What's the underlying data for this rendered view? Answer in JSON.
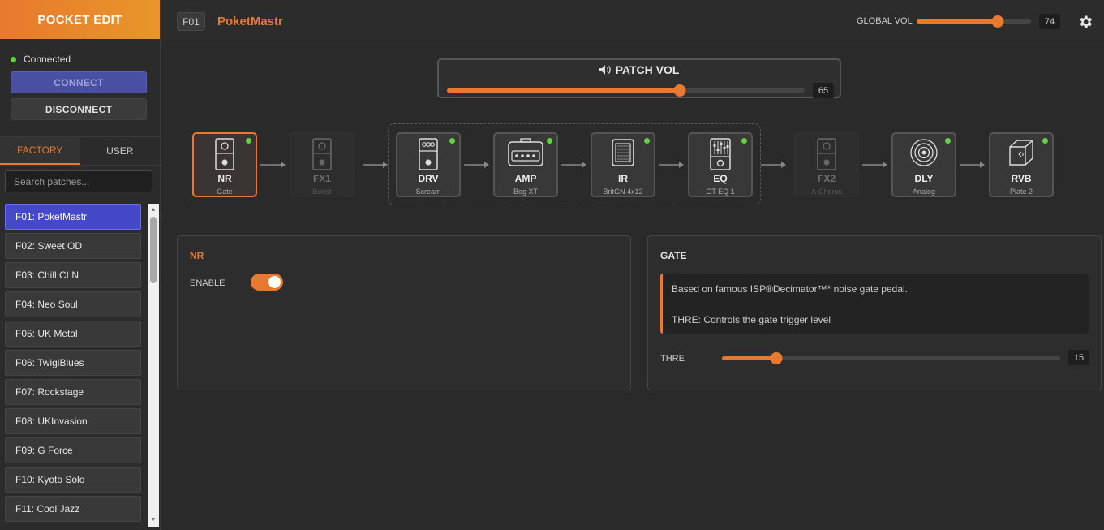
{
  "app": {
    "title": "POCKET EDIT",
    "status": "Connected",
    "connect_label": "CONNECT",
    "disconnect_label": "DISCONNECT"
  },
  "sidebar": {
    "tabs": [
      {
        "label": "FACTORY",
        "active": true
      },
      {
        "label": "USER",
        "active": false
      }
    ],
    "search_placeholder": "Search patches...",
    "patches": [
      {
        "label": "F01: PoketMastr",
        "active": true
      },
      {
        "label": "F02: Sweet OD"
      },
      {
        "label": "F03: Chill CLN"
      },
      {
        "label": "F04: Neo Soul"
      },
      {
        "label": "F05: UK Metal"
      },
      {
        "label": "F06: TwigiBlues"
      },
      {
        "label": "F07: Rockstage"
      },
      {
        "label": "F08: UKInvasion"
      },
      {
        "label": "F09: G Force"
      },
      {
        "label": "F10: Kyoto Solo"
      },
      {
        "label": "F11: Cool Jazz"
      }
    ]
  },
  "header": {
    "patch_id": "F01",
    "patch_name": "PoketMastr",
    "global_vol_label": "GLOBAL VOL",
    "global_vol": 74,
    "global_vol_fill": 0.71
  },
  "patch_vol": {
    "title": "PATCH VOL",
    "value": 65,
    "fill": 0.65
  },
  "chain": [
    {
      "name": "NR",
      "sub": "Gate",
      "on": true,
      "selected": true,
      "icon": "stompbox-icon"
    },
    {
      "name": "FX1",
      "sub": "Boost",
      "on": false,
      "icon": "stompbox-icon"
    },
    {
      "name": "DRV",
      "sub": "Scream",
      "on": true,
      "icon": "drive-pedal-icon"
    },
    {
      "name": "AMP",
      "sub": "Bog XT",
      "on": true,
      "icon": "amp-icon"
    },
    {
      "name": "IR",
      "sub": "BritGN 4x12",
      "on": true,
      "icon": "cabinet-icon"
    },
    {
      "name": "EQ",
      "sub": "GT EQ 1",
      "on": true,
      "icon": "eq-pedal-icon"
    },
    {
      "name": "FX2",
      "sub": "A-Chorus",
      "on": false,
      "icon": "stompbox-icon"
    },
    {
      "name": "DLY",
      "sub": "Analog",
      "on": true,
      "icon": "delay-icon"
    },
    {
      "name": "RVB",
      "sub": "Plate 2",
      "on": true,
      "icon": "reverb-icon"
    }
  ],
  "nr_panel": {
    "title": "NR",
    "enable_label": "ENABLE",
    "enabled": true
  },
  "gate_panel": {
    "title": "GATE",
    "info_line1": "Based on famous ISP®Decimator™* noise gate pedal.",
    "info_line2": "THRE: Controls the gate trigger level",
    "thre_label": "THRE",
    "thre_value": 15,
    "thre_fill": 0.16
  },
  "colors": {
    "accent": "#e8792e",
    "led_on": "#5fd43a",
    "selected_patch": "#4548c9"
  }
}
